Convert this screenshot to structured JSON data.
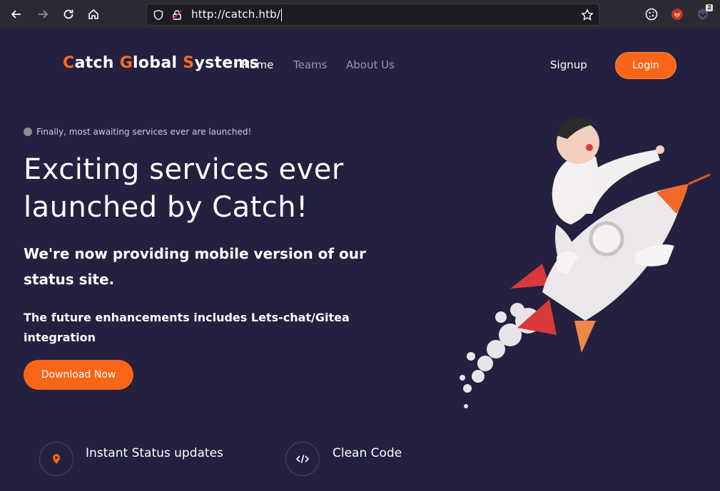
{
  "browser": {
    "url": "http://catch.htb/",
    "extension_badge": "2"
  },
  "header": {
    "logo": {
      "parts": [
        {
          "accent": "C",
          "rest": "atch "
        },
        {
          "accent": "G",
          "rest": "lobal "
        },
        {
          "accent": "S",
          "rest": "ystems"
        }
      ]
    },
    "nav": [
      "Home",
      "Teams",
      "About Us"
    ],
    "signup_label": "Signup",
    "login_label": "Login"
  },
  "hero": {
    "tagline": "Finally, most awaiting services ever are launched!",
    "title": "Exciting services ever launched by Catch!",
    "subtitle": "We're now providing mobile version of our status site.",
    "subtitle2": "The future enhancements includes Lets-chat/Gitea integration",
    "download_label": "Download Now"
  },
  "features": [
    {
      "icon": "location-pin-icon",
      "label": "Instant Status updates"
    },
    {
      "icon": "code-icon",
      "label": "Clean Code"
    }
  ],
  "colors": {
    "background": "#23213f",
    "accent": "#fb6517",
    "browser_bar": "#2b2a33"
  }
}
